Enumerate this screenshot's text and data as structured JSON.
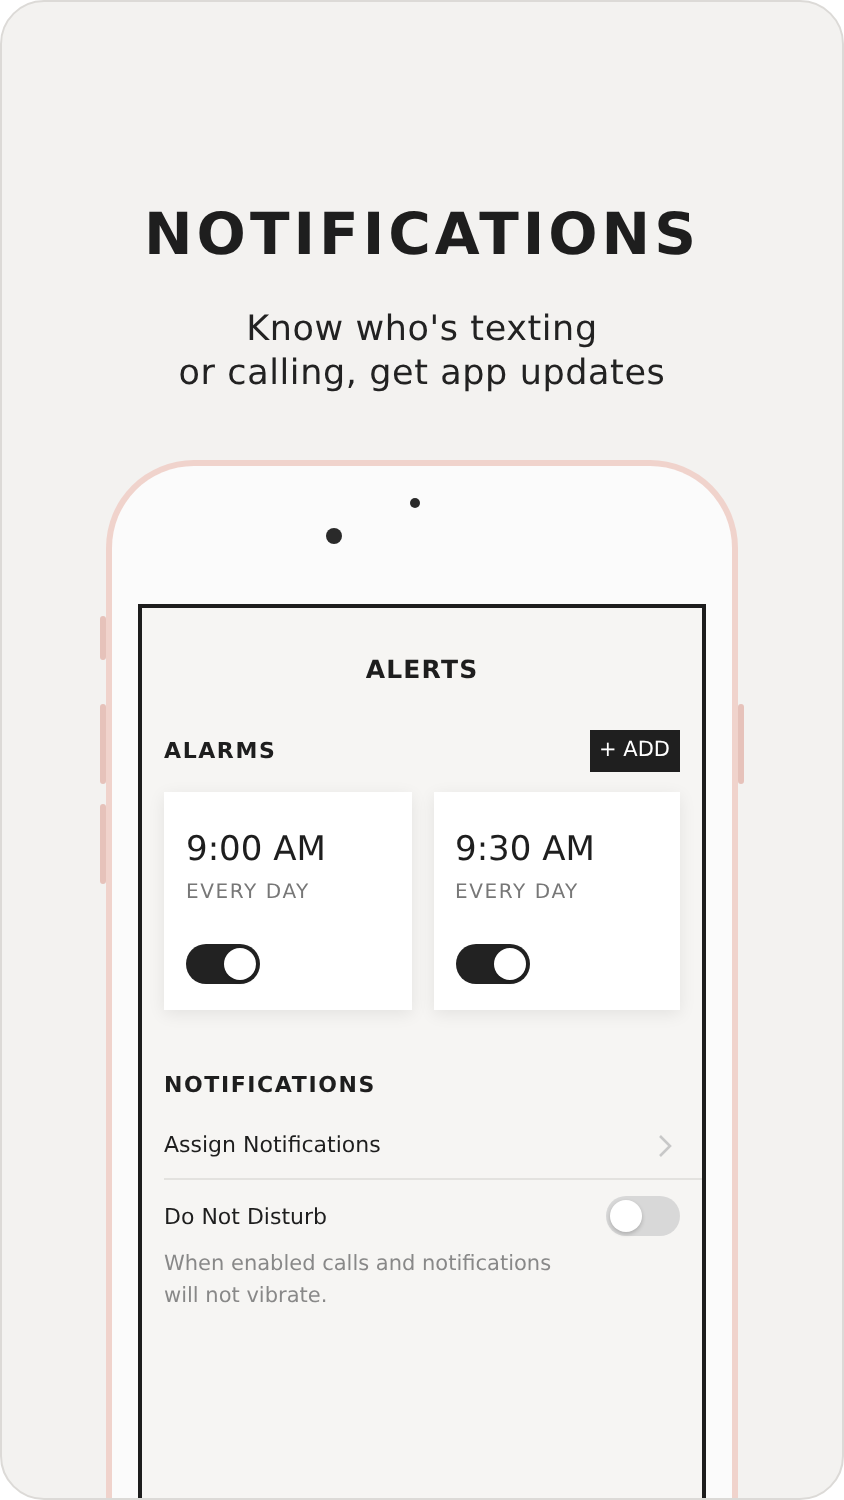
{
  "headline": "NOTIFICATIONS",
  "subtitle_lines": [
    "Know who's texting",
    "or calling, get app updates"
  ],
  "screen": {
    "title": "ALERTS",
    "alarms": {
      "heading": "ALARMS",
      "add_button": "+ ADD",
      "items": [
        {
          "time": "9:00 AM",
          "repeat": "EVERY DAY",
          "on": true
        },
        {
          "time": "9:30 AM",
          "repeat": "EVERY DAY",
          "on": true
        }
      ]
    },
    "notifications": {
      "heading": "NOTIFICATIONS",
      "rows": [
        {
          "kind": "link",
          "label": "Assign Notifications"
        },
        {
          "kind": "toggle",
          "label": "Do Not Disturb",
          "on": false,
          "note": "When enabled calls and notifications will not vibrate."
        }
      ]
    }
  }
}
